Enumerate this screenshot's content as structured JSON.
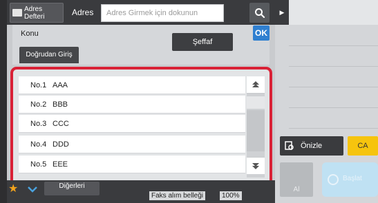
{
  "header": {
    "address_book_label": "Adres Defteri",
    "address_label": "Adres",
    "address_placeholder": "Adres Girmek için dokunun",
    "search_icon": "search-icon"
  },
  "subject": {
    "label": "Konu",
    "transparent_button": "Şeffaf",
    "ok_button": "OK",
    "direct_entry_tab": "Doğrudan Giriş"
  },
  "list": {
    "items": [
      {
        "num": "No.1",
        "name": "AAA"
      },
      {
        "num": "No.2",
        "name": "BBB"
      },
      {
        "num": "No.3",
        "name": "CCC"
      },
      {
        "num": "No.4",
        "name": "DDD"
      },
      {
        "num": "No.5",
        "name": "EEE"
      }
    ]
  },
  "footer": {
    "others_button": "Diğerleri",
    "fax_memory_label": "Faks alım belleği",
    "fax_memory_percent": "100%"
  },
  "right": {
    "preview_button": "Önizle",
    "ca_button": "CA",
    "scan_button": "Al",
    "start_button": "Başlat"
  },
  "colors": {
    "highlight_border": "#d92136",
    "ok_blue": "#2f7fd0",
    "ca_yellow": "#f6c40e",
    "star_orange": "#f2a31c"
  }
}
